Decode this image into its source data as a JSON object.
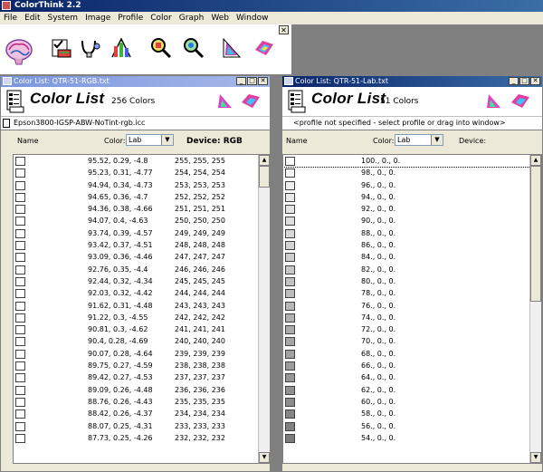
{
  "app": {
    "title": "ColorThink 2.2"
  },
  "menu": [
    "File",
    "Edit",
    "System",
    "Image",
    "Profile",
    "Color",
    "Graph",
    "Web",
    "Window"
  ],
  "toolbar": {
    "close_glyph": "✕"
  },
  "win_left": {
    "title": "Color List: QTR-51-RGB.txt",
    "heading": "Color List",
    "count": "256 Colors",
    "profile": "Epson3800-IGSP-ABW-NoTint-rgb.icc",
    "name_label": "Name",
    "color_label": "Color:",
    "color_value": "Lab",
    "device_label": "Device: RGB",
    "rows": [
      {
        "lab": "95.52, 0.29, -4.8",
        "rgb": "255, 255, 255"
      },
      {
        "lab": "95.23, 0.31, -4.77",
        "rgb": "254, 254, 254"
      },
      {
        "lab": "94.94, 0.34, -4.73",
        "rgb": "253, 253, 253"
      },
      {
        "lab": "94.65, 0.36, -4.7",
        "rgb": "252, 252, 252"
      },
      {
        "lab": "94.36, 0.38, -4.66",
        "rgb": "251, 251, 251"
      },
      {
        "lab": "94.07, 0.4, -4.63",
        "rgb": "250, 250, 250"
      },
      {
        "lab": "93.74, 0.39, -4.57",
        "rgb": "249, 249, 249"
      },
      {
        "lab": "93.42, 0.37, -4.51",
        "rgb": "248, 248, 248"
      },
      {
        "lab": "93.09, 0.36, -4.46",
        "rgb": "247, 247, 247"
      },
      {
        "lab": "92.76, 0.35, -4.4",
        "rgb": "246, 246, 246"
      },
      {
        "lab": "92.44, 0.32, -4.34",
        "rgb": "245, 245, 245"
      },
      {
        "lab": "92.03, 0.32, -4.42",
        "rgb": "244, 244, 244"
      },
      {
        "lab": "91.62, 0.31, -4.48",
        "rgb": "243, 243, 243"
      },
      {
        "lab": "91.22, 0.3, -4.55",
        "rgb": "242, 242, 242"
      },
      {
        "lab": "90.81, 0.3, -4.62",
        "rgb": "241, 241, 241"
      },
      {
        "lab": "90.4, 0.28, -4.69",
        "rgb": "240, 240, 240"
      },
      {
        "lab": "90.07, 0.28, -4.64",
        "rgb": "239, 239, 239"
      },
      {
        "lab": "89.75, 0.27, -4.59",
        "rgb": "238, 238, 238"
      },
      {
        "lab": "89.42, 0.27, -4.53",
        "rgb": "237, 237, 237"
      },
      {
        "lab": "89.09, 0.26, -4.48",
        "rgb": "236, 236, 236"
      },
      {
        "lab": "88.76, 0.26, -4.43",
        "rgb": "235, 235, 235"
      },
      {
        "lab": "88.42, 0.26, -4.37",
        "rgb": "234, 234, 234"
      },
      {
        "lab": "88.07, 0.25, -4.31",
        "rgb": "233, 233, 233"
      },
      {
        "lab": "87.73, 0.25, -4.26",
        "rgb": "232, 232, 232"
      }
    ]
  },
  "win_right": {
    "title": "Color List: QTR-51-Lab.txt",
    "heading": "Color List",
    "count": "51 Colors",
    "profile": "<profile not specified - select profile or drag into window>",
    "name_label": "Name",
    "color_label": "Color:",
    "color_value": "Lab",
    "device_label": "Device:",
    "rows": [
      {
        "lab": "100., 0., 0.",
        "swatch": "#ffffff"
      },
      {
        "lab": "98., 0., 0.",
        "swatch": "#f5f5f5"
      },
      {
        "lab": "96., 0., 0.",
        "swatch": "#efefef"
      },
      {
        "lab": "94., 0., 0.",
        "swatch": "#eaeaea"
      },
      {
        "lab": "92., 0., 0.",
        "swatch": "#e4e4e4"
      },
      {
        "lab": "90., 0., 0.",
        "swatch": "#dedede"
      },
      {
        "lab": "88., 0., 0.",
        "swatch": "#d8d8d8"
      },
      {
        "lab": "86., 0., 0.",
        "swatch": "#d3d3d3"
      },
      {
        "lab": "84., 0., 0.",
        "swatch": "#cdcdcd"
      },
      {
        "lab": "82., 0., 0.",
        "swatch": "#c7c7c7"
      },
      {
        "lab": "80., 0., 0.",
        "swatch": "#c2c2c2"
      },
      {
        "lab": "78., 0., 0.",
        "swatch": "#bcbcbc"
      },
      {
        "lab": "76., 0., 0.",
        "swatch": "#b7b7b7"
      },
      {
        "lab": "74., 0., 0.",
        "swatch": "#b1b1b1"
      },
      {
        "lab": "72., 0., 0.",
        "swatch": "#acacac"
      },
      {
        "lab": "70., 0., 0.",
        "swatch": "#a6a6a6"
      },
      {
        "lab": "68., 0., 0.",
        "swatch": "#a1a1a1"
      },
      {
        "lab": "66., 0., 0.",
        "swatch": "#9c9c9c"
      },
      {
        "lab": "64., 0., 0.",
        "swatch": "#969696"
      },
      {
        "lab": "62., 0., 0.",
        "swatch": "#919191"
      },
      {
        "lab": "60., 0., 0.",
        "swatch": "#8c8c8c"
      },
      {
        "lab": "58., 0., 0.",
        "swatch": "#868686"
      },
      {
        "lab": "56., 0., 0.",
        "swatch": "#818181"
      },
      {
        "lab": "54., 0., 0.",
        "swatch": "#7c7c7c"
      }
    ]
  }
}
